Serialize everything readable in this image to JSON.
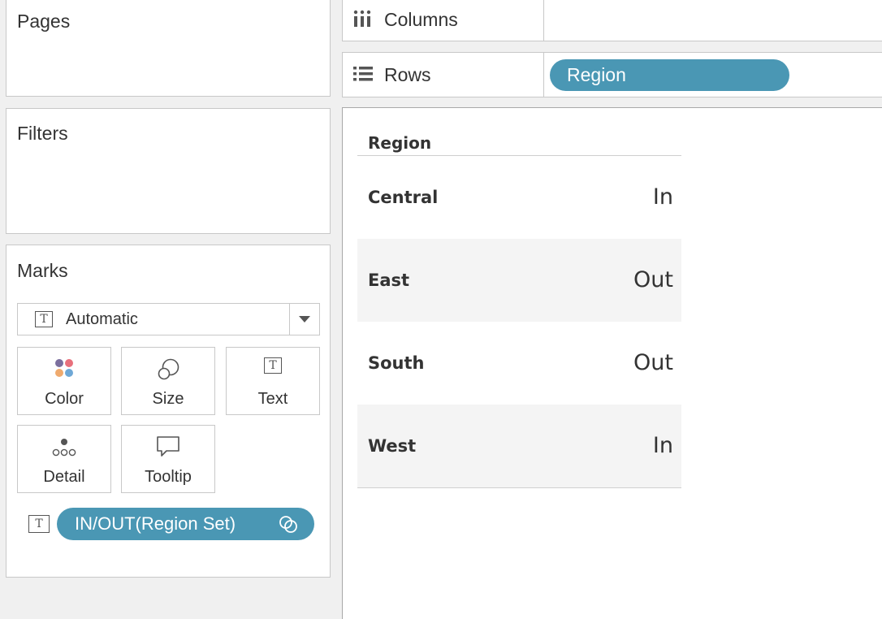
{
  "cards": {
    "pages": "Pages",
    "filters": "Filters",
    "marks": "Marks"
  },
  "marks": {
    "mark_type": "Automatic",
    "buttons": {
      "color": "Color",
      "size": "Size",
      "text": "Text",
      "detail": "Detail",
      "tooltip": "Tooltip"
    },
    "text_pill": "IN/OUT(Region Set)"
  },
  "shelves": {
    "columns": "Columns",
    "rows": "Rows",
    "rows_pill": "Region"
  },
  "table": {
    "header": "Region",
    "rows": [
      {
        "name": "Central",
        "value": "In"
      },
      {
        "name": "East",
        "value": "Out"
      },
      {
        "name": "South",
        "value": "Out"
      },
      {
        "name": "West",
        "value": "In"
      }
    ]
  },
  "colors": {
    "pill": "#4a97b4",
    "color_dots": [
      "#7b6f9e",
      "#e8707c",
      "#efaa6e",
      "#6fa8d6"
    ]
  }
}
